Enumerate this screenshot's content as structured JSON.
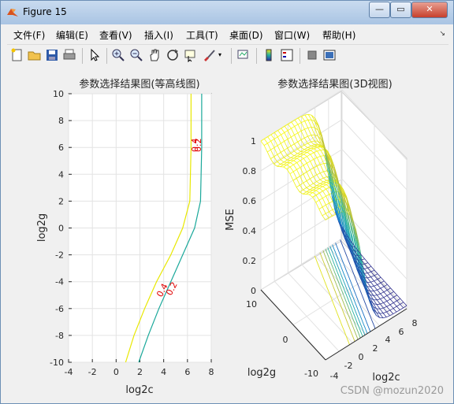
{
  "window": {
    "title": "Figure 15",
    "buttons": {
      "minimize": "—",
      "maximize": "▭",
      "close": "✕"
    }
  },
  "menu": [
    {
      "label": "文件(F)"
    },
    {
      "label": "编辑(E)"
    },
    {
      "label": "查看(V)"
    },
    {
      "label": "插入(I)"
    },
    {
      "label": "工具(T)"
    },
    {
      "label": "桌面(D)"
    },
    {
      "label": "窗口(W)"
    },
    {
      "label": "帮助(H)"
    }
  ],
  "toolbar_icons": [
    "new-figure-icon",
    "open-file-icon",
    "save-icon",
    "print-icon",
    "pointer-icon",
    "zoom-in-icon",
    "zoom-out-icon",
    "pan-icon",
    "rotate-3d-icon",
    "data-cursor-icon",
    "brush-icon",
    "link-plot-icon",
    "colorbar-icon",
    "legend-icon",
    "hide-plot-tools-icon",
    "show-plot-tools-icon"
  ],
  "chart_data": [
    {
      "type": "contour",
      "title": "参数选择结果图(等高线图)",
      "xlabel": "log2c",
      "ylabel": "log2g",
      "xlim": [
        -4,
        8
      ],
      "ylim": [
        -10,
        10
      ],
      "xticks": [
        "-4",
        "-2",
        "0",
        "2",
        "4",
        "6",
        "8"
      ],
      "yticks": [
        "10",
        "8",
        "6",
        "4",
        "2",
        "0",
        "-2",
        "-4",
        "-6",
        "-8",
        "-10"
      ],
      "grid": true,
      "contour_labels": [
        "0.4",
        "0.2",
        "0.4",
        "0.2"
      ],
      "series": [
        {
          "level": 0.4,
          "color": "#e8e800",
          "x": [
            0.8,
            1.5,
            2.4,
            3.4,
            4.6,
            5.6,
            6.2,
            6.3,
            6.3
          ],
          "y": [
            -10,
            -8,
            -6,
            -4,
            -2,
            0,
            2,
            6,
            10
          ]
        },
        {
          "level": 0.2,
          "color": "#1aa89a",
          "x": [
            1.9,
            2.7,
            3.6,
            4.6,
            5.6,
            6.6,
            7.1,
            7.2,
            7.2
          ],
          "y": [
            -10,
            -8,
            -6,
            -4,
            -2,
            0,
            2,
            6,
            10
          ]
        }
      ]
    },
    {
      "type": "surface3d",
      "title": "参数选择结果图(3D视图)",
      "xlabel": "log2c",
      "ylabel": "log2g",
      "zlabel": "MSE",
      "xticks": [
        "-4",
        "-2",
        "0",
        "2",
        "4",
        "6",
        "8"
      ],
      "yticks": [
        "10",
        "0",
        "-10"
      ],
      "zticks": [
        "0",
        "0.2",
        "0.4",
        "0.6",
        "0.8",
        "1"
      ],
      "zlim": [
        0,
        1
      ]
    }
  ],
  "watermark": "CSDN @mozun2020"
}
